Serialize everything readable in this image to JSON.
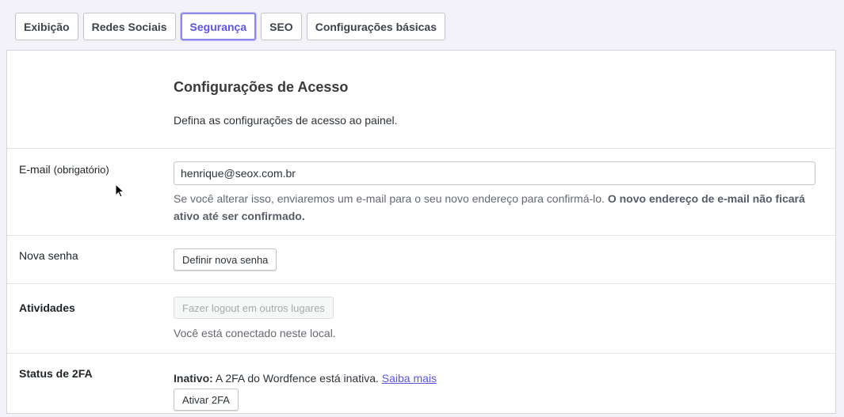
{
  "tabs": [
    {
      "label": "Exibição"
    },
    {
      "label": "Redes Sociais"
    },
    {
      "label": "Segurança"
    },
    {
      "label": "SEO"
    },
    {
      "label": "Configurações básicas"
    }
  ],
  "active_tab": "Segurança",
  "section": {
    "title": "Configurações de Acesso",
    "description": "Defina as configurações de acesso ao painel."
  },
  "email": {
    "label": "E-mail",
    "label_note": "(obrigatório)",
    "value": "henrique@seox.com.br",
    "hint": "Se você alterar isso, enviaremos um e-mail para o seu novo endereço para confirmá-lo.",
    "hint_bold": "O novo endereço de e-mail não ficará ativo até ser confirmado."
  },
  "password": {
    "label": "Nova senha",
    "button": "Definir nova senha"
  },
  "sessions": {
    "label": "Atividades",
    "button": "Fazer logout em outros lugares",
    "note": "Você está conectado neste local."
  },
  "twofa": {
    "label": "Status de 2FA",
    "status_label": "Inativo:",
    "status_text": "A 2FA do Wordfence está inativa.",
    "link": "Saiba mais",
    "button": "Ativar 2FA"
  },
  "colors": {
    "accent": "#5a55e6",
    "background": "#f2f2f8"
  }
}
